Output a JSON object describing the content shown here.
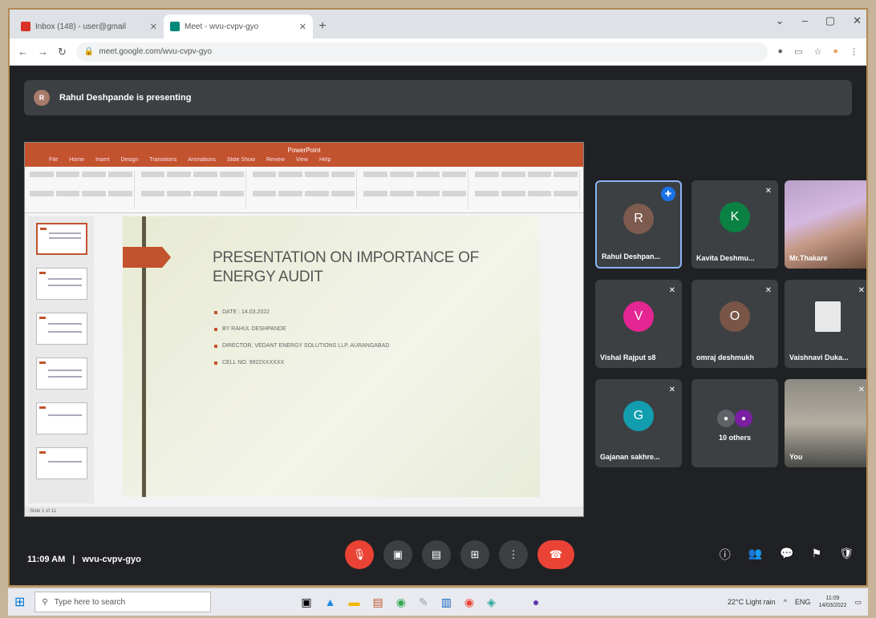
{
  "browser": {
    "tabs": [
      {
        "title": "Inbox (148) - user@gmail",
        "active": false,
        "favicon_color": "#d93025"
      },
      {
        "title": "Meet - wvu-cvpv-gyo",
        "active": true,
        "favicon_color": "#00897b"
      }
    ],
    "new_tab": "+",
    "url": "meet.google.com/wvu-cvpv-gyo",
    "window_controls": [
      "⌄",
      "–",
      "▢",
      "✕"
    ]
  },
  "presenting_banner": {
    "avatar_letter": "R",
    "text": "Rahul Deshpande is presenting"
  },
  "slide": {
    "app_title": "PowerPoint",
    "menu": [
      "File",
      "Home",
      "Insert",
      "Design",
      "Transitions",
      "Animations",
      "Slide Show",
      "Review",
      "View",
      "Help"
    ],
    "title": "PRESENTATION ON IMPORTANCE OF ENERGY AUDIT",
    "bullets": [
      "DATE : 14.03.2022",
      "BY RAHUL DESHPANDE",
      "DIRECTOR, VEDANT ENERGY SOLUTIONS LLP, AURANGABAD",
      "CELL NO. 9922XXXXXX"
    ],
    "status": "Slide 1 of 11"
  },
  "participants": [
    {
      "name": "Rahul Deshpan...",
      "letter": "R",
      "color": "#7d5b4f",
      "pinned": true
    },
    {
      "name": "Kavita Deshmu...",
      "letter": "K",
      "color": "#0b8043",
      "pinned": false
    },
    {
      "name": "Mr.Thakare",
      "letter": "",
      "color": "",
      "photo": true
    },
    {
      "name": "Vishal Rajput s8",
      "letter": "V",
      "color": "#e52592",
      "pinned": false
    },
    {
      "name": "omraj deshmukh",
      "letter": "O",
      "color": "#795548",
      "pinned": false
    },
    {
      "name": "Vaishnavi Duka...",
      "letter": "",
      "color": "#3c4043",
      "pinned": false
    },
    {
      "name": "Gajanan sakhre...",
      "letter": "G",
      "color": "#129eaf",
      "pinned": false
    },
    {
      "name": "10 others",
      "letter": "",
      "color": "",
      "others": true
    },
    {
      "name": "You",
      "letter": "",
      "color": "",
      "photo": true
    }
  ],
  "meeting": {
    "time": "11:09 AM",
    "separator": "|",
    "code": "wvu-cvpv-gyo"
  },
  "controls": {
    "mic_icon": "🎙",
    "camera_icon": "▣",
    "captions_icon": "▤",
    "present_icon": "⊞",
    "more_icon": "⋮",
    "end_icon": "☎"
  },
  "right_controls": [
    "ⓘ",
    "👥",
    "💬",
    "⚑",
    "🛡"
  ],
  "taskbar": {
    "search_placeholder": "Type here to search",
    "weather": "22°C  Light rain",
    "lang": "ENG",
    "time": "11:09",
    "date": "14/03/2022"
  }
}
